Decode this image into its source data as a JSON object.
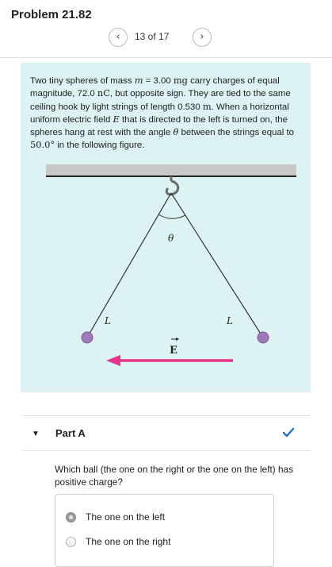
{
  "header": {
    "title": "Problem 21.82",
    "pager": {
      "prev_icon": "chevron-left-icon",
      "next_icon": "chevron-right-icon",
      "count": "13 of 17"
    }
  },
  "problem": {
    "t1": "Two tiny spheres of mass ",
    "m_var": "m",
    "t2": " = 3.00 ",
    "mg_unit": "mg",
    "t3": " carry charges of equal magnitude, 72.0 ",
    "nC_unit": "nC",
    "t4": ", but opposite sign. They are tied to the same ceiling hook by light strings of length 0.530 ",
    "m_unit": "m",
    "t5": ". When a horizontal uniform electric field ",
    "E_var": "E",
    "t6": " that is directed to the left is turned on, the spheres hang at rest with the angle ",
    "theta_var": "θ",
    "t7": " between the strings equal to ",
    "angle_value": "50.0°",
    "t8": " in the following figure."
  },
  "figure": {
    "theta_label": "θ",
    "left_string_label": "L",
    "right_string_label": "L",
    "field_label": "E",
    "colors": {
      "ball": "#a07ab8",
      "field_arrow": "#e6348b",
      "ceiling": "#c8c8c8"
    }
  },
  "part_a": {
    "toggle_icon": "▼",
    "title": "Part A",
    "status_icon": "checkmark-icon",
    "status_color": "#2a6fb5",
    "question": "Which ball (the one on the right or the one on the left) has positive charge?",
    "options": [
      {
        "label": "The one on the left",
        "selected": true
      },
      {
        "label": "The one on the right",
        "selected": false
      }
    ]
  }
}
